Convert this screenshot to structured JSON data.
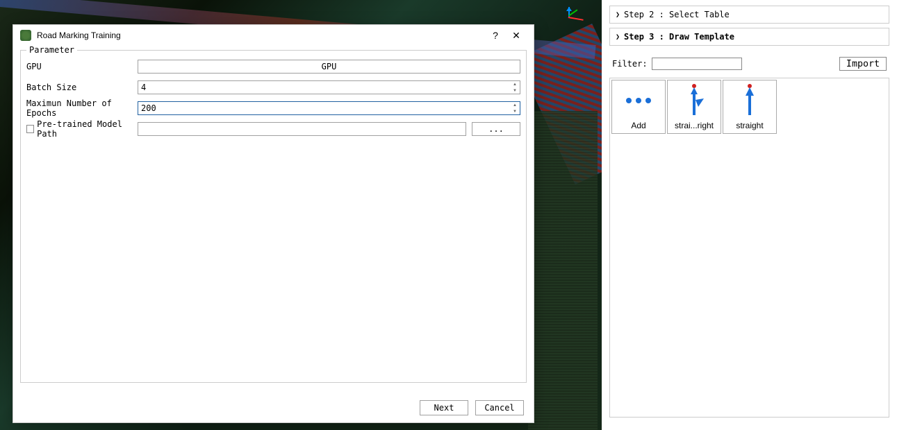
{
  "dialog": {
    "title": "Road Marking Training",
    "help_symbol": "?",
    "close_symbol": "✕",
    "fieldset_legend": "Parameter",
    "gpu": {
      "label": "GPU",
      "value": "GPU"
    },
    "batch_size": {
      "label": "Batch Size",
      "value": "4"
    },
    "epochs": {
      "label": "Maximun Number of Epochs",
      "value": "200"
    },
    "pretrained": {
      "label": "Pre-trained Model Path",
      "checked": false,
      "path": "",
      "browse_label": "..."
    },
    "footer": {
      "next": "Next",
      "cancel": "Cancel"
    }
  },
  "right": {
    "step2": "Step 2 : Select Table",
    "step3": "Step 3 : Draw Template",
    "filter_label": "Filter:",
    "filter_value": "",
    "import_label": "Import",
    "items": [
      {
        "label": "Add",
        "kind": "add"
      },
      {
        "label": "strai...right",
        "kind": "straight-right"
      },
      {
        "label": "straight",
        "kind": "straight"
      }
    ]
  }
}
